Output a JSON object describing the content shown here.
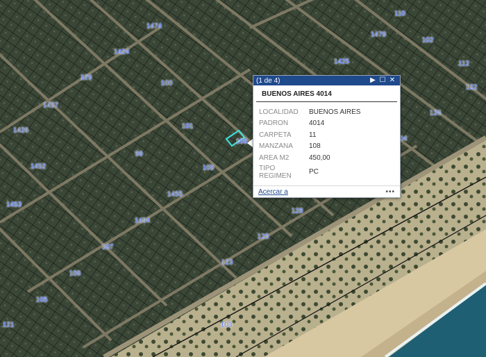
{
  "map": {
    "block_labels": [
      "129",
      "1424",
      "1474",
      "1479",
      "1425",
      "1426",
      "1427",
      "1453",
      "1452",
      "1454",
      "1455",
      "109",
      "107",
      "106",
      "108",
      "128",
      "105",
      "125",
      "124",
      "123",
      "122",
      "121",
      "104",
      "103",
      "102",
      "110",
      "112",
      "101",
      "100",
      "99"
    ],
    "colors": {
      "land": "#3d4a3a",
      "dune": "#cdbf9e",
      "beach": "#e6d6b4",
      "sea": "#1e5f73",
      "parcel": "#111111",
      "selection": "#3fe3e0",
      "label": "#5a7cff"
    }
  },
  "popup": {
    "counter": "(1 de 4)",
    "title": "BUENOS AIRES 4014",
    "attributes": [
      {
        "key": "LOCALIDAD",
        "value": "BUENOS AIRES"
      },
      {
        "key": "PADRON",
        "value": "4014"
      },
      {
        "key": "CARPETA",
        "value": "11"
      },
      {
        "key": "MANZANA",
        "value": "108"
      },
      {
        "key": "AREA M2",
        "value": "450,00"
      },
      {
        "key": "TIPO REGIMEN",
        "value": "PC"
      }
    ],
    "zoom_link": "Acercar a",
    "more": "•••",
    "next_icon": "▶",
    "maximize_icon": "☐",
    "close_icon": "✕"
  }
}
